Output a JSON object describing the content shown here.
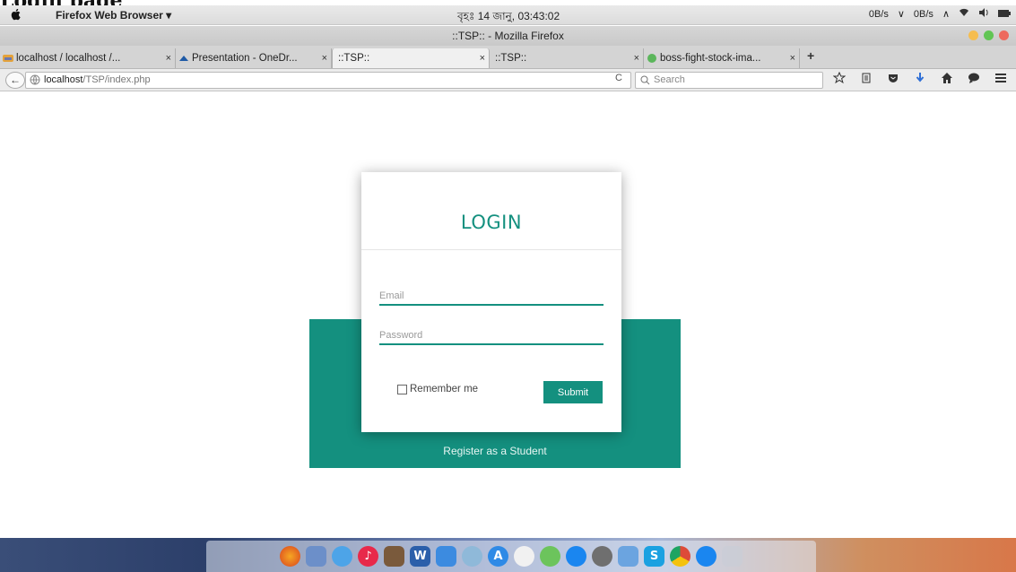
{
  "doc_heading": "Login page",
  "system_bar": {
    "app_menu": "Firefox Web Browser ▾",
    "clock": "বৃহঃ 14 জানু, 03:43:02",
    "tray": [
      "0B/s",
      "∨",
      "0B/s",
      "∧"
    ]
  },
  "window": {
    "title": "::TSP:: - Mozilla Firefox"
  },
  "tabs": [
    {
      "label": "localhost / localhost /...",
      "active": false
    },
    {
      "label": "Presentation - OneDr...",
      "active": false
    },
    {
      "label": "::TSP::",
      "active": true
    },
    {
      "label": "::TSP::",
      "active": false
    },
    {
      "label": "boss-fight-stock-ima...",
      "active": false
    }
  ],
  "tab_close": "×",
  "new_tab": "+",
  "nav": {
    "back": "←",
    "url_host": "localhost",
    "url_path": "/TSP/index.php",
    "reload": "C",
    "search_placeholder": "Search"
  },
  "login": {
    "title": "LOGIN",
    "email_placeholder": "Email",
    "password_placeholder": "Password",
    "remember_label": "Remember me",
    "submit_label": "Submit",
    "register_link": "Register as a Student"
  },
  "colors": {
    "accent": "#14907f"
  },
  "dock_icons": [
    "firefox-icon",
    "preview-icon",
    "messages-icon",
    "music-icon",
    "photo-icon",
    "word-icon",
    "finder-icon",
    "system-icon",
    "app-store-icon",
    "ical-icon",
    "maps-icon",
    "messenger-icon",
    "settings-icon",
    "xcode-icon",
    "skype-icon",
    "chrome-icon",
    "messenger2-icon",
    "launchpad-icon"
  ]
}
